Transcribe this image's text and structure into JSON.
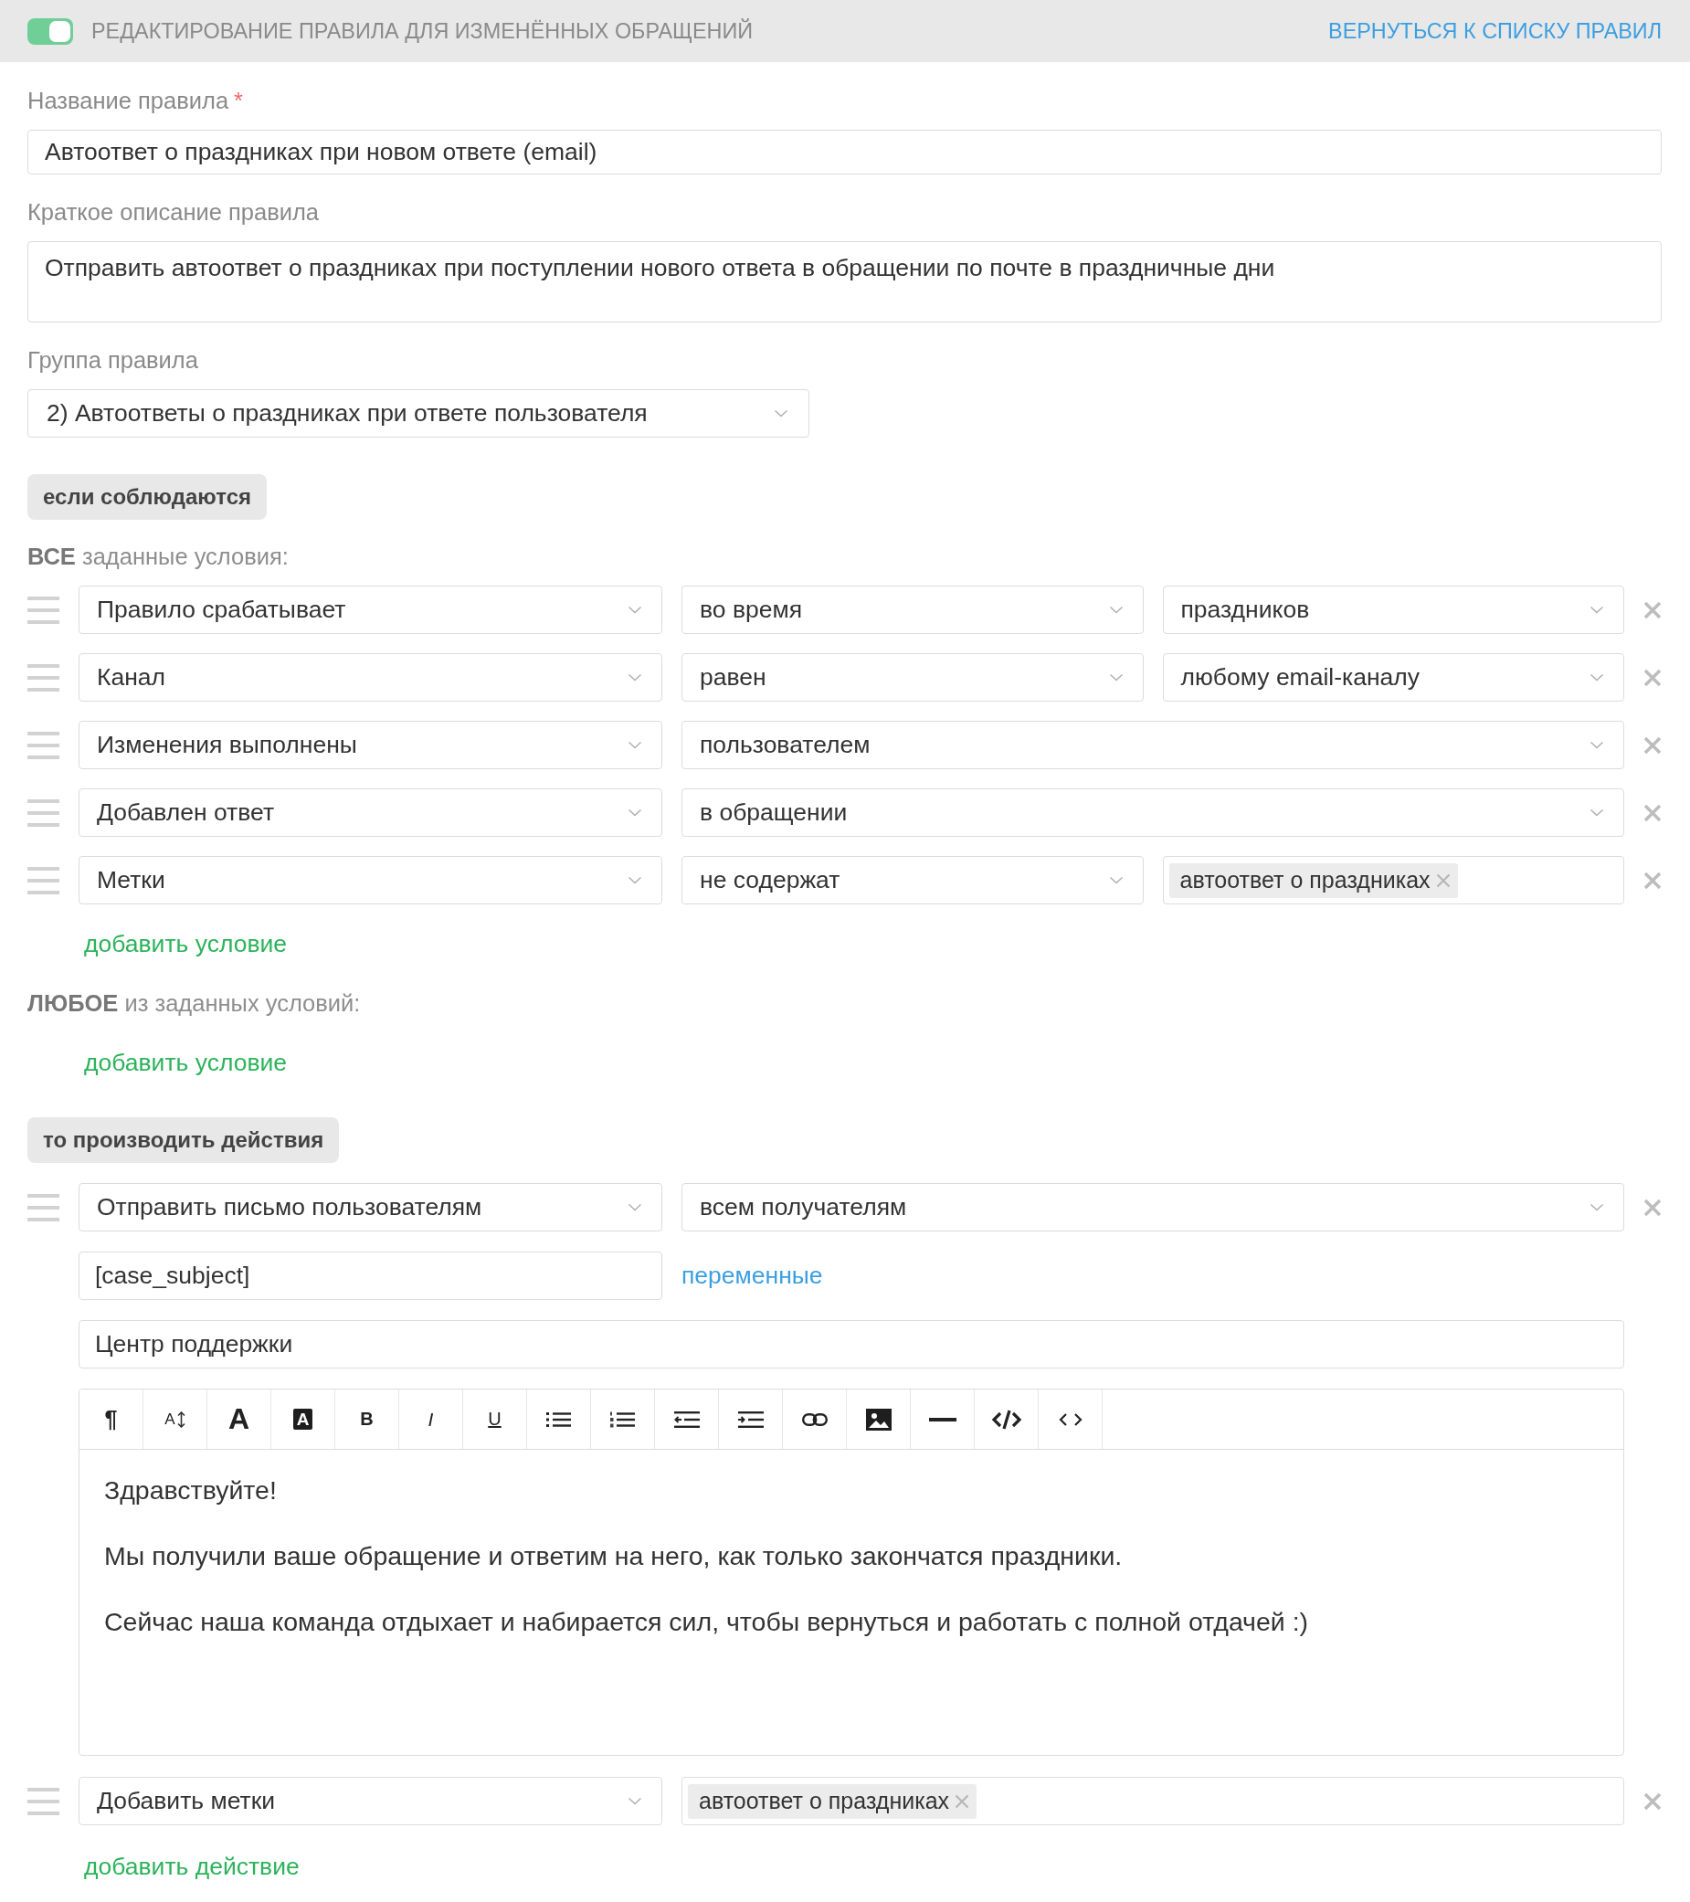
{
  "header": {
    "enabled": true,
    "title": "РЕДАКТИРОВАНИЕ ПРАВИЛА ДЛЯ ИЗМЕНЁННЫХ ОБРАЩЕНИЙ",
    "back_link": "ВЕРНУТЬСЯ К СПИСКУ ПРАВИЛ"
  },
  "fields": [
    {
      "kind": "input",
      "label": "Название правила",
      "required_mark": "*",
      "value": "Автоответ о праздниках при новом ответе (email)"
    },
    {
      "kind": "textarea",
      "label": "Краткое описание правила",
      "value": "Отправить автоответ о праздниках при поступлении нового ответа в обращении по почте в праздничные дни"
    },
    {
      "kind": "select",
      "label": "Группа правила",
      "value": "2) Автоответы о праздниках при ответе пользователя"
    }
  ],
  "conditions": {
    "heading": "если соблюдаются",
    "groups": [
      {
        "heading": "**ВСЕ** заданные условия:",
        "rows": [
          {
            "fields": [
              {
                "kind": "select",
                "value": "Правило срабатывает"
              },
              {
                "kind": "select",
                "value": "во время"
              },
              {
                "kind": "select",
                "value": "праздников"
              }
            ]
          },
          {
            "fields": [
              {
                "kind": "select",
                "value": "Канал"
              },
              {
                "kind": "select",
                "value": "равен"
              },
              {
                "kind": "select",
                "value": "любому email-каналу"
              }
            ]
          },
          {
            "fields": [
              {
                "kind": "select",
                "value": "Изменения выполнены"
              },
              {
                "kind": "select",
                "value": "пользователем"
              }
            ]
          },
          {
            "fields": [
              {
                "kind": "select",
                "value": "Добавлен ответ"
              },
              {
                "kind": "select",
                "value": "в обращении"
              }
            ]
          },
          {
            "fields": [
              {
                "kind": "select",
                "value": "Метки"
              },
              {
                "kind": "select",
                "value": "не содержат"
              },
              {
                "kind": "tags",
                "tags": [
                  "автоответ о праздниках"
                ]
              }
            ]
          }
        ],
        "add_link": "добавить условие"
      },
      {
        "heading": "**ЛЮБОЕ** из заданных условий:",
        "add_link": "добавить условие"
      }
    ]
  },
  "actions": {
    "heading": "то производить действия",
    "items": [
      {
        "kind": "email",
        "fields": [
          {
            "kind": "select",
            "value": "Отправить письмо пользователям"
          },
          {
            "kind": "select",
            "value": "всем получателям"
          }
        ],
        "subject": "[case_subject]",
        "variables_link": "переменные",
        "sender": "Центр поддержки",
        "editor": {
          "toolbar": [
            {
              "kind": "paragraph",
              "label": "¶"
            },
            {
              "kind": "fontsize",
              "label": "A"
            },
            {
              "kind": "forecolor",
              "label": "A"
            },
            {
              "kind": "backcolor",
              "label": "A"
            },
            {
              "kind": "bold",
              "label": "B"
            },
            {
              "kind": "italic",
              "label": "I"
            },
            {
              "kind": "underline",
              "label": "U"
            },
            {
              "kind": "bullets"
            },
            {
              "kind": "numbers"
            },
            {
              "kind": "outdent"
            },
            {
              "kind": "indent"
            },
            {
              "kind": "link"
            },
            {
              "kind": "image"
            },
            {
              "kind": "rule"
            },
            {
              "kind": "code"
            },
            {
              "kind": "source"
            }
          ],
          "paragraphs": [
            "Здравствуйте!",
            "Мы получили ваше обращение и ответим на него, как только закончатся праздники.",
            "Сейчас наша команда отдыхает и набирается сил, чтобы вернуться и работать с полной отдачей :)"
          ]
        }
      },
      {
        "kind": "tags",
        "fields": [
          {
            "kind": "select",
            "value": "Добавить метки"
          },
          {
            "kind": "tags",
            "tags": [
              "автоответ о праздниках"
            ]
          }
        ]
      }
    ],
    "add_link": "добавить действие"
  }
}
